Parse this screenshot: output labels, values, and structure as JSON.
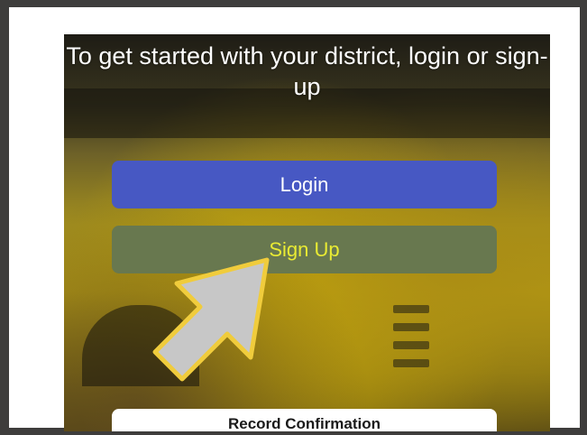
{
  "screen": {
    "headline": "To get started with your district, login or sign-up",
    "login_label": "Login",
    "signup_label": "Sign Up",
    "bottom_card_label": "Record Confirmation"
  },
  "annotation": {
    "icon": "pointer-arrow-icon",
    "fill_color": "#c7c7c7",
    "outline_color": "#f0cc3c"
  },
  "colors": {
    "login_button": "#4758c3",
    "signup_button": "#68784f",
    "signup_text": "#e9eb33",
    "outer_border": "#3e3d3c"
  }
}
